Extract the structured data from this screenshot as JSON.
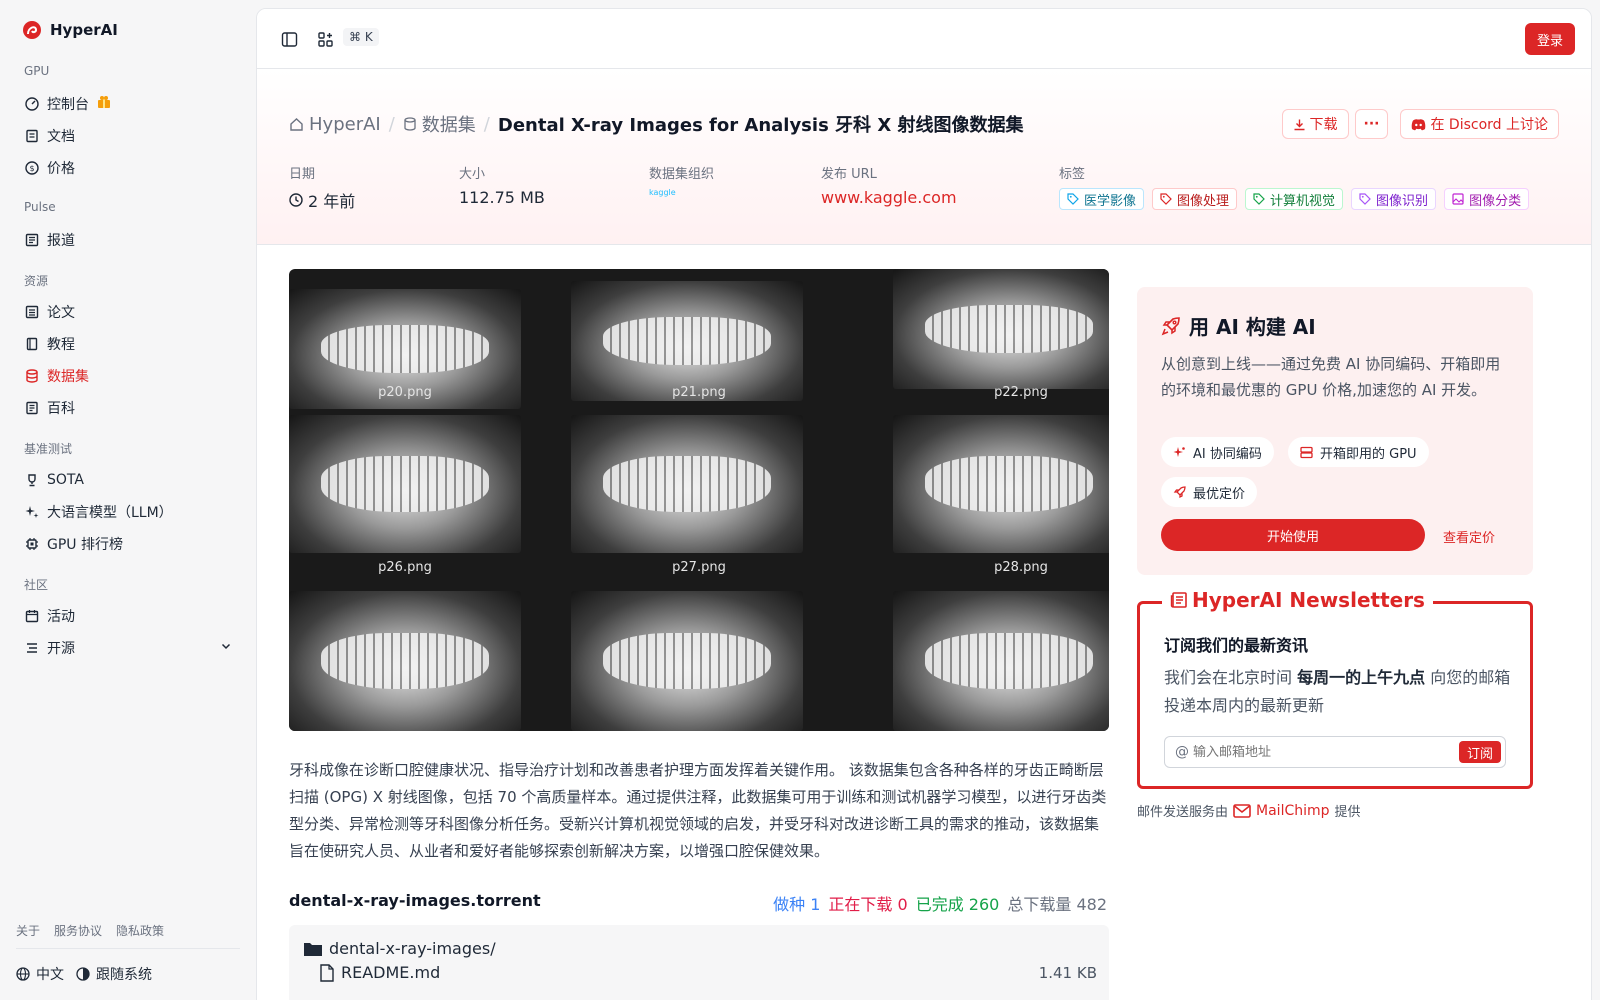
{
  "brand": {
    "name": "HyperAI"
  },
  "sidebar": {
    "groups": [
      {
        "title": "GPU",
        "items": [
          {
            "label": "控制台",
            "icon": "gauge-icon"
          },
          {
            "label": "文档",
            "icon": "book-icon"
          },
          {
            "label": "价格",
            "icon": "dollar-icon"
          }
        ]
      },
      {
        "title": "Pulse",
        "items": [
          {
            "label": "报道",
            "icon": "newspaper-icon"
          }
        ]
      },
      {
        "title": "资源",
        "items": [
          {
            "label": "论文",
            "icon": "paper-icon"
          },
          {
            "label": "教程",
            "icon": "notebook-icon"
          },
          {
            "label": "数据集",
            "icon": "database-icon",
            "active": true
          },
          {
            "label": "百科",
            "icon": "encyclopedia-icon"
          }
        ]
      },
      {
        "title": "基准测试",
        "items": [
          {
            "label": "SOTA",
            "icon": "trophy-icon"
          },
          {
            "label": "大语言模型（LLM）",
            "icon": "sparkle-icon"
          },
          {
            "label": "GPU 排行榜",
            "icon": "chip-icon"
          }
        ]
      },
      {
        "title": "社区",
        "items": [
          {
            "label": "活动",
            "icon": "calendar-icon"
          },
          {
            "label": "开源",
            "icon": "list-icon"
          }
        ]
      }
    ],
    "footer_links": [
      "关于",
      "服务协议",
      "隐私政策"
    ],
    "language": "中文",
    "theme": "跟随系统"
  },
  "topbar": {
    "shortcut": "⌘ K",
    "login": "登录"
  },
  "breadcrumb": {
    "home": "HyperAI",
    "section": "数据集",
    "current": "Dental X-ray Images for Analysis 牙科 X 射线图像数据集"
  },
  "actions": {
    "download": "下载",
    "more": "···",
    "discord": "在 Discord 上讨论"
  },
  "meta": {
    "date_label": "日期",
    "date_value": "2 年前",
    "size_label": "大小",
    "size_value": "112.75 MB",
    "org_label": "数据集组织",
    "org_value": "kaggle",
    "url_label": "发布 URL",
    "url_value": "www.kaggle.com",
    "tags_label": "标签",
    "tags": [
      {
        "label": "医学影像",
        "color": "#0ea5e9"
      },
      {
        "label": "图像处理",
        "color": "#dc2626"
      },
      {
        "label": "计算机视觉",
        "color": "#16a34a"
      },
      {
        "label": "图像识别",
        "color": "#a855f7"
      },
      {
        "label": "图像分类",
        "color": "#c026d3"
      }
    ]
  },
  "hero_images": [
    "p20.png",
    "p21.png",
    "p22.png",
    "p26.png",
    "p27.png",
    "p28.png"
  ],
  "description": "牙科成像在诊断口腔健康状况、指导治疗计划和改善患者护理方面发挥着关键作用。 该数据集包含各种各样的牙齿正畸断层扫描 (OPG) X 射线图像，包括 70 个高质量样本。通过提供注释，此数据集可用于训练和测试机器学习模型，以进行牙齿类型分类、异常检测等牙科图像分析任务。受新兴计算机视觉领域的启发，并受牙科对改进诊断工具的需求的推动，该数据集旨在使研究人员、从业者和爱好者能够探索创新解决方案，以增强口腔保健效果。",
  "torrent": {
    "name": "dental-x-ray-images.torrent",
    "seeding_label": "做种",
    "seeding": "1",
    "downloading_label": "正在下载",
    "downloading": "0",
    "completed_label": "已完成",
    "completed": "260",
    "total_label": "总下载量",
    "total": "482",
    "folder": "dental-x-ray-images/",
    "files": [
      {
        "name": "README.md",
        "size": "1.41 KB"
      }
    ]
  },
  "promo": {
    "title": "用 AI 构建 AI",
    "text": "从创意到上线——通过免费 AI 协同编码、开箱即用的环境和最优惠的 GPU 价格,加速您的 AI 开发。",
    "chip1": "AI 协同编码",
    "chip2": "开箱即用的 GPU",
    "chip3": "最优定价",
    "start": "开始使用",
    "pricing": "查看定价"
  },
  "newsletter": {
    "title": "HyperAI Newsletters",
    "heading": "订阅我们的最新资讯",
    "text_before": "我们会在北京时间 ",
    "text_bold": "每周一的上午九点",
    "text_after": " 向您的邮箱投递本周内的最新更新",
    "placeholder": "输入邮箱地址",
    "subscribe": "订阅",
    "mail_prefix": "邮件发送服务由",
    "mail_brand": "MailChimp",
    "mail_suffix": "提供"
  },
  "colors": {
    "accent": "#dc2626",
    "seeding": "#3b82f6",
    "downloading": "#e11d48",
    "completed": "#16a34a"
  }
}
